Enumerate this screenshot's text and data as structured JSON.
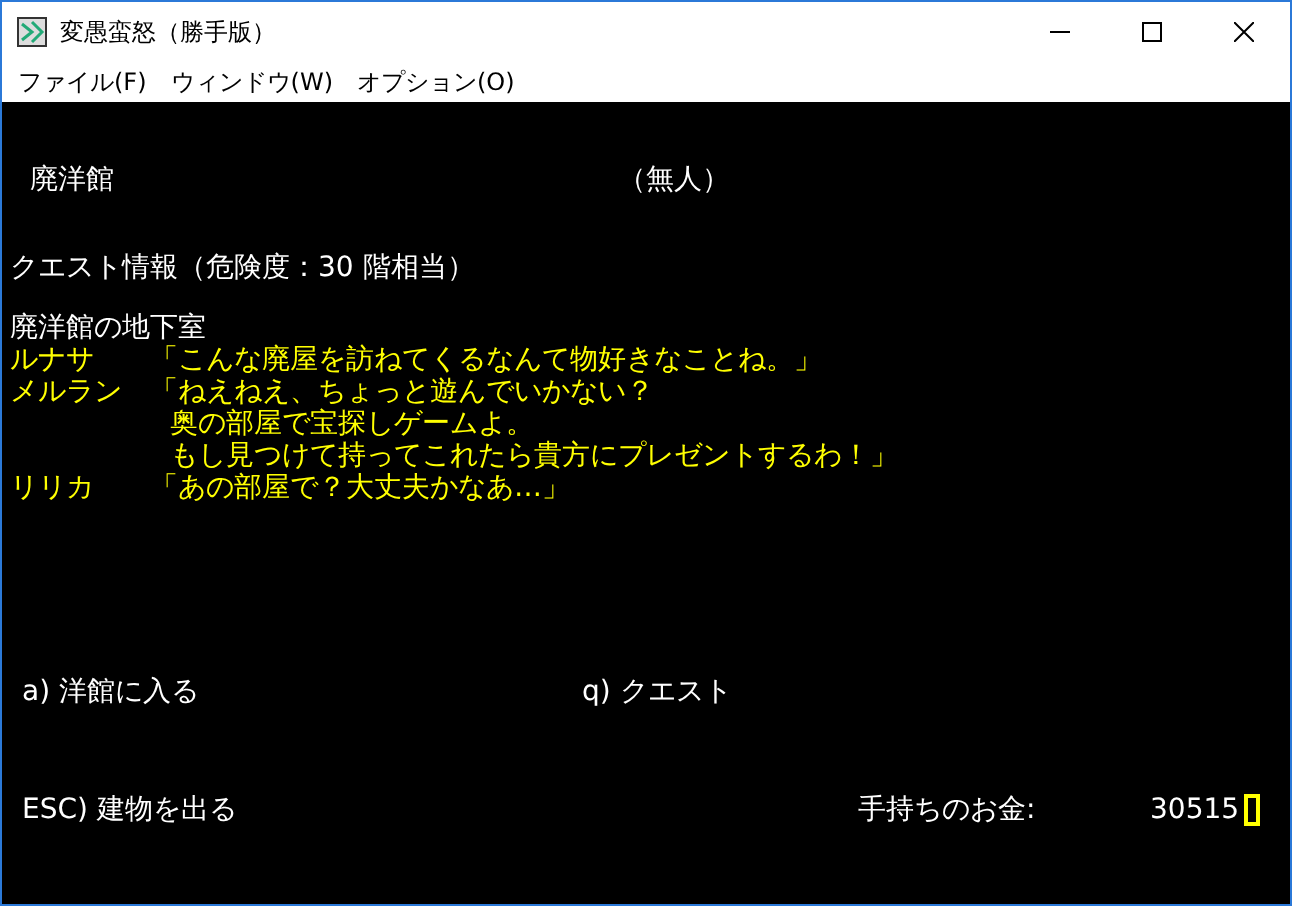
{
  "window": {
    "title": "変愚蛮怒（勝手版）"
  },
  "menu": [
    "ファイル(F)",
    "ウィンドウ(W)",
    "オプション(O)"
  ],
  "location": {
    "name": "廃洋館",
    "status": "（無人）"
  },
  "quest_info": "クエスト情報（危険度：30 階相当）",
  "quest_title": "廃洋館の地下室",
  "dialogue": [
    {
      "speaker": "ルナサ",
      "lines": [
        "「こんな廃屋を訪ねてくるなんて物好きなことね。」"
      ]
    },
    {
      "speaker": "メルラン",
      "lines": [
        "「ねえねえ、ちょっと遊んでいかない？",
        "奥の部屋で宝探しゲームよ。",
        "もし見つけて持ってこれたら貴方にプレゼントするわ！」"
      ]
    },
    {
      "speaker": "リリカ",
      "lines": [
        "「あの部屋で？大丈夫かなあ…」"
      ]
    }
  ],
  "options": [
    "a) 洋館に入る",
    "q) クエスト"
  ],
  "exit": "ESC) 建物を出る",
  "money": {
    "label": "手持ちのお金:",
    "value": "30515"
  }
}
